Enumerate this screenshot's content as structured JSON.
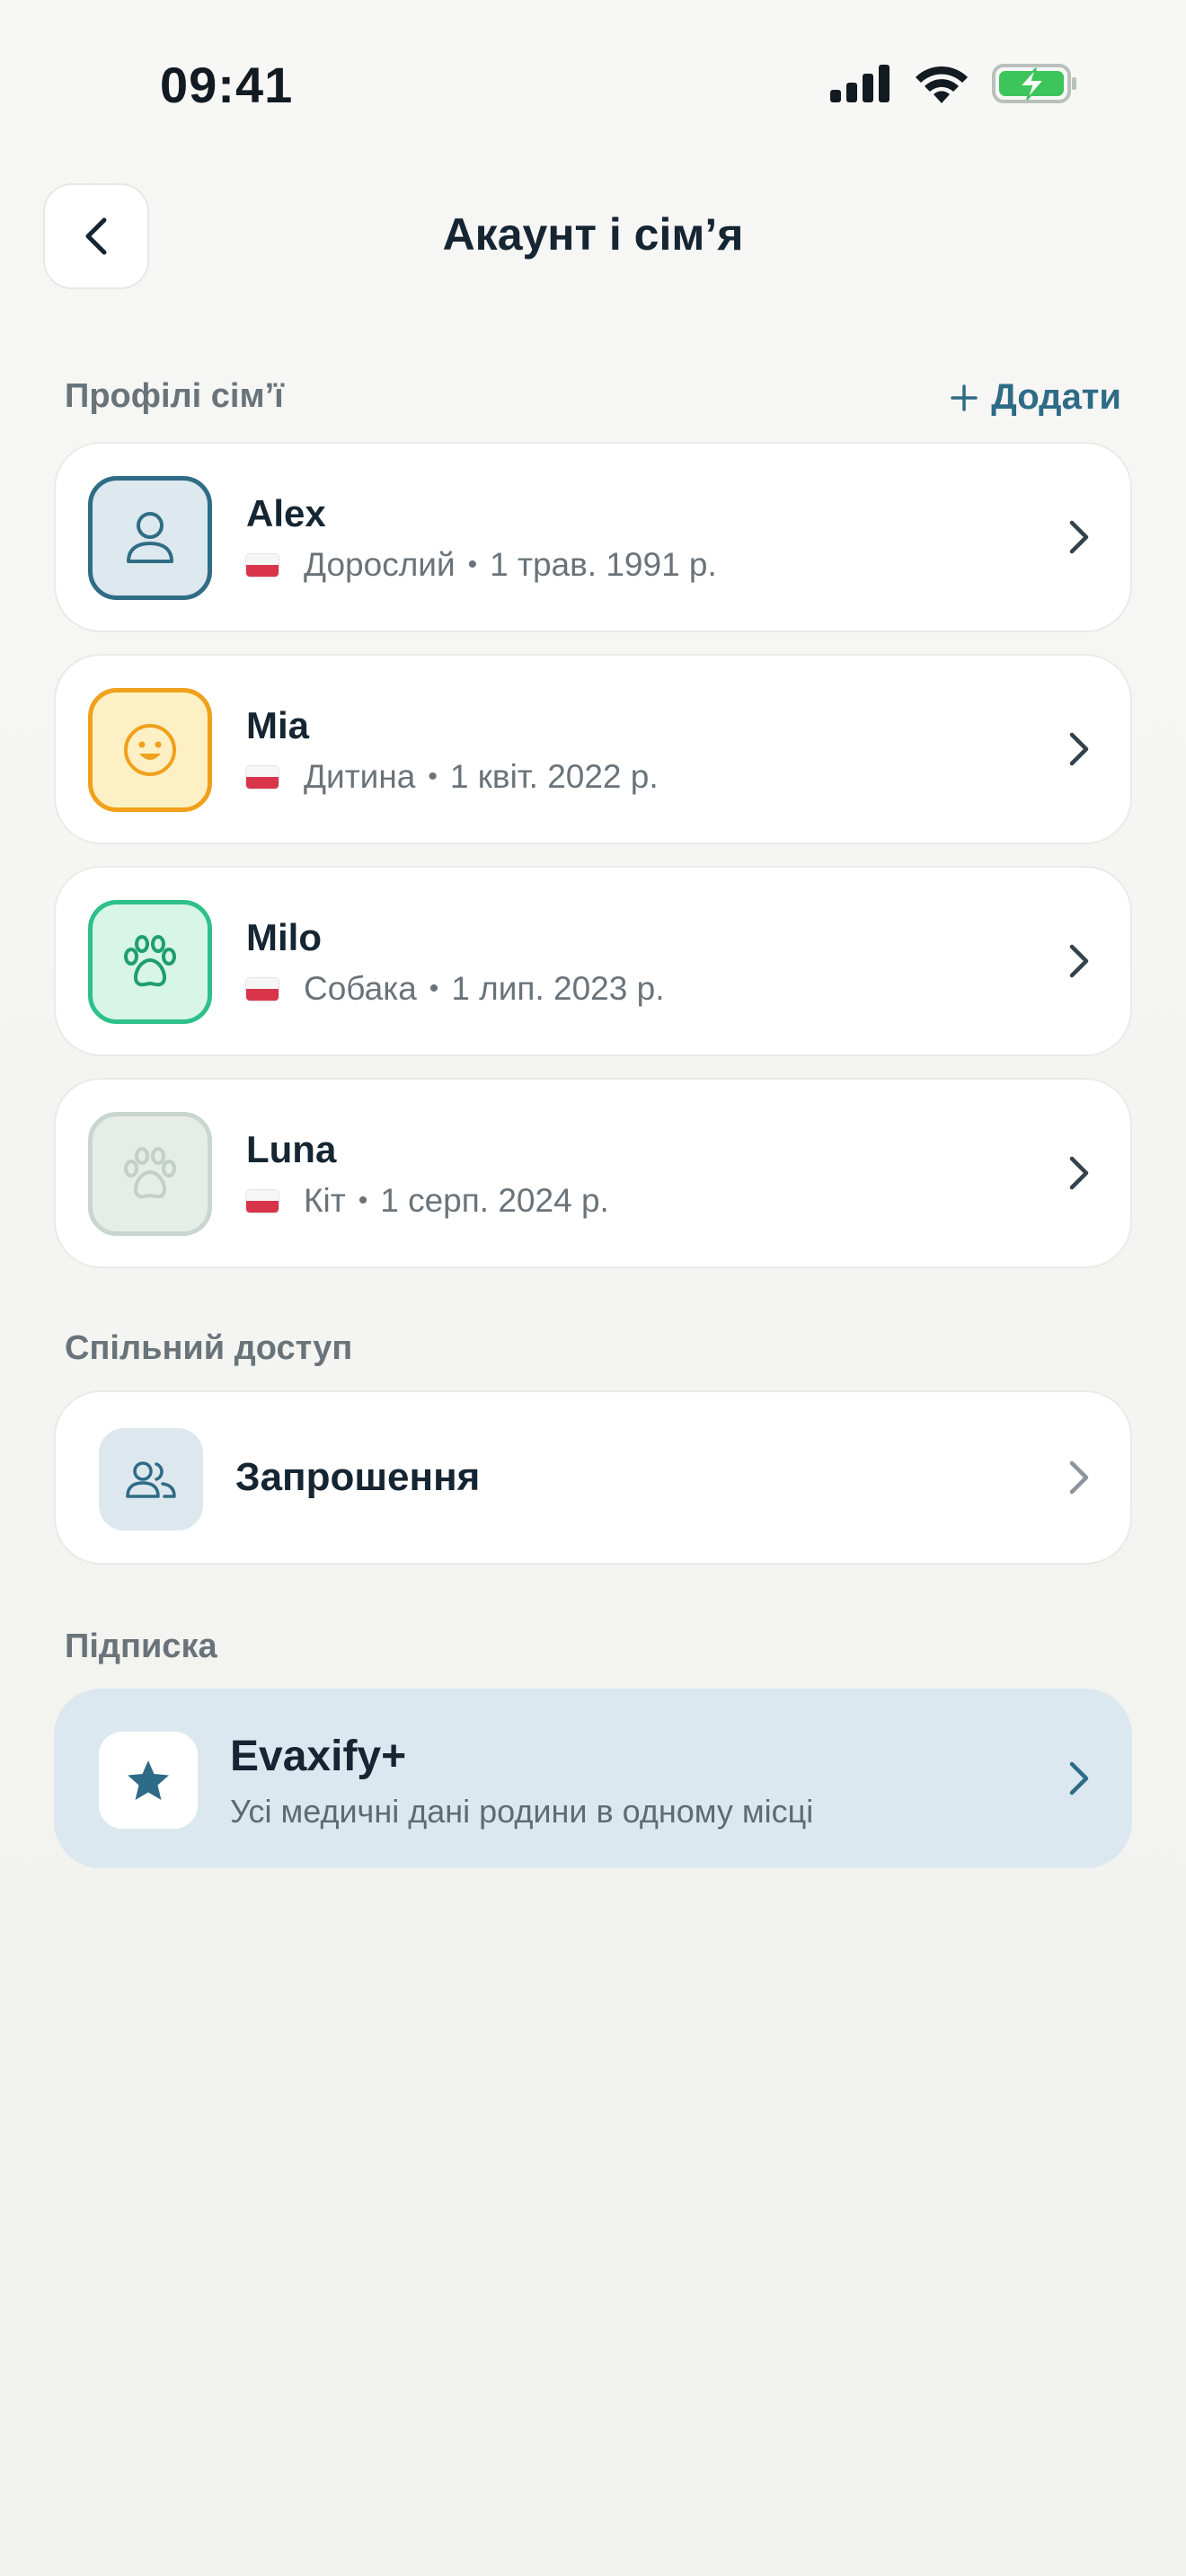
{
  "status_bar": {
    "time": "09:41"
  },
  "header": {
    "title": "Акаунт і сім’я"
  },
  "profiles_section": {
    "label": "Профілі сім’ї",
    "add_label": "Додати",
    "profiles": [
      {
        "name": "Alex",
        "type": "Дорослий",
        "date": "1 трав. 1991 р.",
        "icon": "person-icon",
        "accent": "#2f6d86",
        "bg": "#dde8ef"
      },
      {
        "name": "Mia",
        "type": "Дитина",
        "date": "1 квіт. 2022 р.",
        "icon": "smiley-face-icon",
        "accent": "#f0a01b",
        "bg": "#fdf0c4"
      },
      {
        "name": "Milo",
        "type": "Собака",
        "date": "1 лип. 2023 р.",
        "icon": "paw-icon",
        "accent": "#2ec08a",
        "bg": "#d7f6e7"
      },
      {
        "name": "Luna",
        "type": "Кіт",
        "date": "1 серп. 2024 р.",
        "icon": "paw-icon",
        "accent": "#c9d6d0",
        "bg": "#e6ece8"
      }
    ]
  },
  "sharing_section": {
    "label": "Спільний доступ",
    "invitations_label": "Запрошення"
  },
  "subscription_section": {
    "label": "Підписка",
    "plan_name": "Evaxify+",
    "plan_description": "Усі медичні дані родини в одному місці"
  },
  "colors": {
    "primary": "#2e6b86",
    "text": "#152532",
    "muted": "#69737a",
    "background": "#f3f3f1"
  }
}
